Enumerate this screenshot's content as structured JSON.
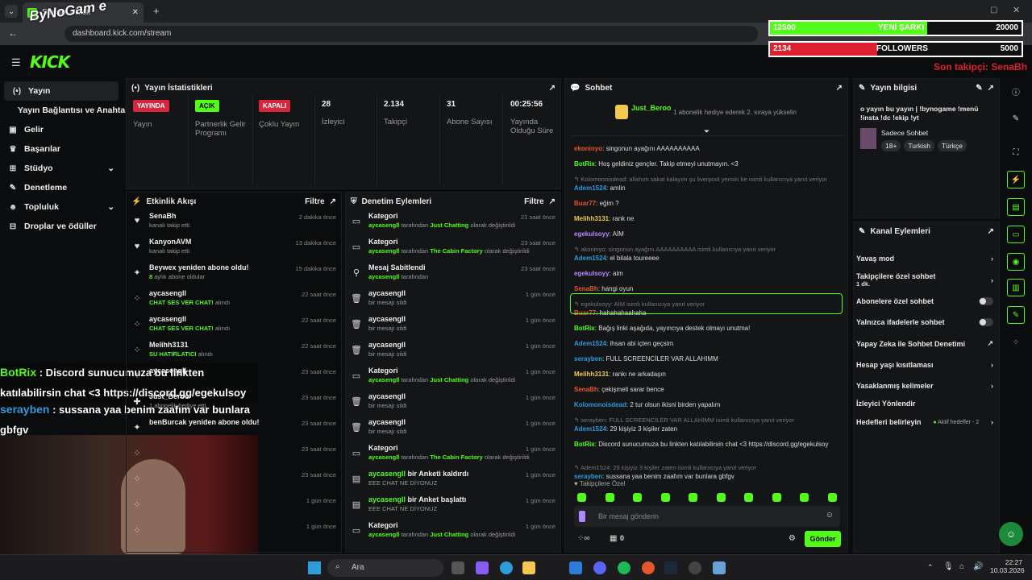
{
  "browser": {
    "tab_title": "Stream - Kick",
    "url": "dashboard.kick.com/stream"
  },
  "overlay": {
    "logo_text": "ByNoGam e",
    "bar1": {
      "current": "12500",
      "label": "YENİ ŞARKI",
      "goal": "20000",
      "progress": 0.625
    },
    "bar2": {
      "current": "2134",
      "label": "FOLLOWERS",
      "goal": "5000",
      "progress": 0.4268
    },
    "last_follower": "Son takipçi: SenaBh",
    "chat_lines": [
      {
        "user": "BotRix",
        "text": " : Discord sunucumuza bu linkten katılabilirsin chat <3 https://discord.gg/egekulsoy"
      },
      {
        "user": "serayben",
        "text": " : sussana yaa benim zaafım var bunlara gbfgv"
      }
    ]
  },
  "nav": {
    "logo": "KICK"
  },
  "sidebar": {
    "items": [
      {
        "label": "Yayın",
        "icon": "broadcast-icon"
      },
      {
        "label": "Yayın Bağlantısı ve Anahtarı",
        "icon": ""
      },
      {
        "label": "Gelir",
        "icon": "revenue-icon"
      },
      {
        "label": "Başarılar",
        "icon": "trophy-icon"
      },
      {
        "label": "Stüdyo",
        "icon": "studio-icon"
      },
      {
        "label": "Denetleme",
        "icon": "wrench-icon"
      },
      {
        "label": "Topluluk",
        "icon": "community-icon"
      },
      {
        "label": "Droplar ve ödüller",
        "icon": "drops-icon"
      }
    ]
  },
  "stats": {
    "title": "Yayın İstatistikleri",
    "items": [
      {
        "badge": "YAYINDA",
        "label": "Yayın"
      },
      {
        "badge": "AÇIK",
        "label": "Partnerlik Gelir Programı"
      },
      {
        "badge": "KAPALI",
        "label": "Çoklu Yayın"
      },
      {
        "value": "28",
        "label": "İzleyici"
      },
      {
        "value": "2.134",
        "label": "Takipçi"
      },
      {
        "value": "31",
        "label": "Abone Sayısı"
      },
      {
        "value": "00:25:56",
        "label": "Yayında Olduğu Süre"
      }
    ]
  },
  "activity": {
    "title": "Etkinlik Akışı",
    "filter": "Filtre",
    "items": [
      {
        "name": "SenaBh",
        "sub": "kanalı takip etti",
        "time": "2 dakika önce",
        "icon": "heart-icon"
      },
      {
        "name": "KanyonAVM",
        "sub": "kanalı takip etti",
        "time": "13 dakika önce",
        "icon": "heart-icon"
      },
      {
        "name": "Beywex yeniden abone oldu!",
        "sub": "aylık abone oldular",
        "subhl": "8",
        "time": "15 dakika önce",
        "icon": "star-icon"
      },
      {
        "name": "aycasengll",
        "sub": "alındı",
        "subhl": "CHAT SES VER CHAT!",
        "time": "22 saat önce",
        "icon": "points-icon"
      },
      {
        "name": "aycasengll",
        "sub": "alındı",
        "subhl": "CHAT SES VER CHAT!",
        "time": "22 saat önce",
        "icon": "points-icon"
      },
      {
        "name": "Melihh3131",
        "sub": "alındı",
        "subhl": "SU HATIRLATICI",
        "time": "22 saat önce",
        "icon": "points-icon"
      },
      {
        "name": "aycasengll",
        "sub": "",
        "time": "23 saat önce",
        "icon": "points-icon"
      },
      {
        "name": "Just_Beroo",
        "sub": "1 abonelik hediye etti.",
        "time": "23 saat önce",
        "icon": "gift-icon"
      },
      {
        "name": "benBurcak yeniden abone oldu!",
        "sub": "",
        "time": "23 saat önce",
        "icon": "star-icon"
      },
      {
        "name": "",
        "sub": "",
        "time": "23 saat önce",
        "icon": "points-icon"
      },
      {
        "name": "",
        "sub": "",
        "time": "23 saat önce",
        "icon": "points-icon"
      },
      {
        "name": "",
        "sub": "",
        "time": "1 gün önce",
        "icon": "points-icon"
      },
      {
        "name": "",
        "sub": "",
        "time": "1 gün önce",
        "icon": "points-icon"
      }
    ]
  },
  "moderation": {
    "title": "Denetim Eylemleri",
    "filter": "Filtre",
    "items": [
      {
        "name": "Kategori",
        "sub": "aycasengll|tarafından |Just Chatting| olarak değiştirildi",
        "time": "21 saat önce",
        "icon": "category-icon"
      },
      {
        "name": "Kategori",
        "sub": "aycasengll|tarafından |The Cabin Factory| olarak değiştirildi",
        "time": "23 saat önce",
        "icon": "category-icon"
      },
      {
        "name": "Mesaj Sabitlendi",
        "sub": "aycasengll|tarafından||",
        "time": "23 saat önce",
        "icon": "pin-icon"
      },
      {
        "name": "aycasengll",
        "sub": "|bir mesajı sildi||",
        "time": "1 gün önce",
        "icon": "trash-icon"
      },
      {
        "name": "aycasengll",
        "sub": "|bir mesajı sildi||",
        "time": "1 gün önce",
        "icon": "trash-icon"
      },
      {
        "name": "aycasengll",
        "sub": "|bir mesajı sildi||",
        "time": "1 gün önce",
        "icon": "trash-icon"
      },
      {
        "name": "Kategori",
        "sub": "aycasengll|tarafından |Just Chatting| olarak değiştirildi",
        "time": "1 gün önce",
        "icon": "category-icon"
      },
      {
        "name": "aycasengll",
        "sub": "|bir mesajı sildi||",
        "time": "1 gün önce",
        "icon": "trash-icon"
      },
      {
        "name": "aycasengll",
        "sub": "|bir mesajı sildi||",
        "time": "1 gün önce",
        "icon": "trash-icon"
      },
      {
        "name": "Kategori",
        "sub": "aycasengll|tarafından |The Cabin Factory| olarak değiştirildi",
        "time": "1 gün önce",
        "icon": "category-icon"
      },
      {
        "name": "aycasengll bir Anketi kaldırdı",
        "sub": "|EEE CHAT NE DİYONUZ||",
        "time": "1 gün önce",
        "icon": "poll-icon"
      },
      {
        "name": "aycasengll bir Anket başlattı",
        "sub": "|EEE CHAT NE DİYONUZ||",
        "time": "1 gün önce",
        "icon": "poll-icon"
      },
      {
        "name": "Kategori",
        "sub": "aycasengll|tarafından |Just Chatting| olarak değiştirildi",
        "time": "1 gün önce",
        "icon": "category-icon"
      }
    ]
  },
  "chat": {
    "title": "Sohbet",
    "gift_user": "Just_Beroo",
    "gift_text": "1 abonelik hediye ederek 2. sıraya yükselin",
    "placeholder": "Bir mesaj gönderin",
    "send": "Gönder",
    "followers_only": "Takipçilere Özel",
    "points": "0",
    "messages": [
      {
        "type": "msg",
        "user": "ekoninyo",
        "color": "#e4572e",
        "text": "singonun ayağını AAAAAAAAAA"
      },
      {
        "type": "msg",
        "user": "BotRix",
        "color": "#53fc18",
        "text": "Hoş geldiniz gençler. Takip etmeyi unutmayın. <3"
      },
      {
        "type": "reply",
        "text": "Kolomonoisdead: allahım sakat kalayım şu liverpool yensin be isimli kullanıcıya yanıt veriyor"
      },
      {
        "type": "msg",
        "user": "Adem1524",
        "color": "#2d9cdb",
        "text": "amlin"
      },
      {
        "type": "msg",
        "user": "Buar77",
        "color": "#e4572e",
        "text": "eğim ?"
      },
      {
        "type": "msg",
        "user": "Melihh3131",
        "color": "#f2c94c",
        "text": "rank ne"
      },
      {
        "type": "msg",
        "user": "egekulsoyy",
        "color": "#b388ff",
        "text": "AİM"
      },
      {
        "type": "reply",
        "text": "akoninyo: singonun ayağını AAAAAAAAAA isimli kullanıcıya yanıt veriyor"
      },
      {
        "type": "msg",
        "user": "Adem1524",
        "color": "#2d9cdb",
        "text": "el bilala toureeee"
      },
      {
        "type": "msg",
        "user": "egekulsoyy",
        "color": "#b388ff",
        "text": "aim"
      },
      {
        "type": "msg",
        "user": "SenaBh",
        "color": "#e4572e",
        "text": "hangi oyun"
      },
      {
        "type": "reply",
        "text": "egekulsoyy: AİM isimli kullanıcıya yanıt veriyor"
      },
      {
        "type": "msg",
        "user": "Buar77",
        "color": "#e4572e",
        "text": "hahahahaahaha"
      },
      {
        "type": "msg",
        "user": "BotRix",
        "color": "#53fc18",
        "text": "Bağış linki aşağıda, yayıncıya destek olmayı unutma!"
      },
      {
        "type": "msg",
        "user": "Adem1524",
        "color": "#2d9cdb",
        "text": "ihsan abi içten geçsim"
      },
      {
        "type": "msg",
        "user": "serayben",
        "color": "#2d9cdb",
        "text": "FULL SCREENCİLER VAR ALLAHIMM"
      },
      {
        "type": "msg",
        "user": "Melihh3131",
        "color": "#f2c94c",
        "text": "rankı ne arkadaşın"
      },
      {
        "type": "msg",
        "user": "SenaBh",
        "color": "#e4572e",
        "text": "çekişmeli sarar bence"
      },
      {
        "type": "msg",
        "user": "Kolomonoisdead",
        "color": "#2d9cdb",
        "text": "2 tur olsun ikisni birden yapalım"
      },
      {
        "type": "reply",
        "text": "serayben: FULL SCREENCİLER VAR ALLAHIMM isimli kullanıcıya yanıt veriyor"
      },
      {
        "type": "msg",
        "user": "Adem1524",
        "color": "#2d9cdb",
        "text": "29 kişiyiz 3 kişiler zaten"
      },
      {
        "type": "msg",
        "user": "BotRix",
        "color": "#53fc18",
        "text": "Discord sunucumuza bu linkten katılabilirsin chat <3 https://discord.gg/egekulsoy"
      },
      {
        "type": "reply",
        "text": "Adem1524: 29 kişiyiz 3 kişiler zaten isimli kullanıcıya yanıt veriyor"
      },
      {
        "type": "msg",
        "user": "serayben",
        "color": "#2d9cdb",
        "text": "sussana yaa benim zaafım var bunlara gbfgv"
      }
    ]
  },
  "stream_info": {
    "title": "Yayın bilgisi",
    "text": "o yayın bu yayın | !bynogame !menü !insta !dc !ekip !yt",
    "category": "Sadece Sohbet",
    "tags": [
      "18+",
      "Turkish",
      "Türkçe"
    ]
  },
  "channel_actions": {
    "title": "Kanal Eylemleri",
    "items": [
      {
        "label": "Yavaş mod",
        "ctl": "chevron"
      },
      {
        "label": "Takipçilere özel sohbet",
        "sub": "1 dk.",
        "ctl": "chevron"
      },
      {
        "label": "Abonelere özel sohbet",
        "ctl": "toggle"
      },
      {
        "label": "Yalnızca ifadelerle sohbet",
        "ctl": "toggle"
      },
      {
        "label": "Yapay Zeka ile Sohbet Denetimi",
        "ctl": "external"
      },
      {
        "label": "Hesap yaşı kısıtlaması",
        "ctl": "chevron"
      },
      {
        "label": "Yasaklanmış kelimeler",
        "ctl": "chevron"
      },
      {
        "label": "İzleyici Yönlendir",
        "ctl": "none"
      },
      {
        "label": "Hedefleri belirleyin",
        "sub2": "Aktif hedefler - 2",
        "ctl": "chevron"
      }
    ]
  },
  "taskbar": {
    "search": "Ara",
    "time": "22:27",
    "date": "10.03.2026"
  }
}
